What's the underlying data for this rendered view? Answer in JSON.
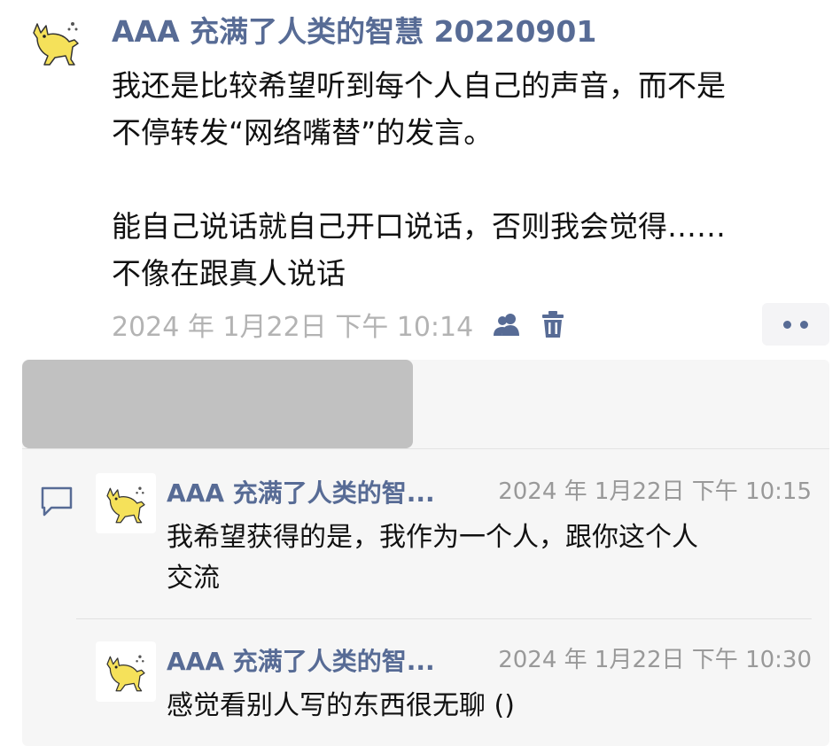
{
  "post": {
    "author": "AAA 充满了人类的智慧 20220901",
    "avatar_icon": "yellow-cat-icon",
    "lines": [
      "我还是比较希望听到每个人自己的声音，而不是",
      "不停转发“网络嘴替”的发言。",
      "",
      "能自己说话就自己开口说话，否则我会觉得……",
      "不像在跟真人说话"
    ],
    "timestamp": "2024 年 1月22日 下午 10:14",
    "privacy_icon": "friends-icon",
    "delete_icon": "trash-icon",
    "more_icon": "more-dots-icon"
  },
  "comments": [
    {
      "author": "AAA 充满了人类的智...",
      "time": "2024 年 1月22日 下午 10:15",
      "lines": [
        "我希望获得的是，我作为一个人，跟你这个人",
        "交流"
      ]
    },
    {
      "author": "AAA 充满了人类的智...",
      "time": "2024 年 1月22日 下午 10:30",
      "lines": [
        "感觉看别人写的东西很无聊 ()"
      ]
    }
  ],
  "colors": {
    "name": "#576b95",
    "timestamp": "#b3b3b3",
    "panel": "#f6f6f6",
    "likes_redacted": "#c1c1c1",
    "avatar_yellow": "#f5e15a"
  }
}
